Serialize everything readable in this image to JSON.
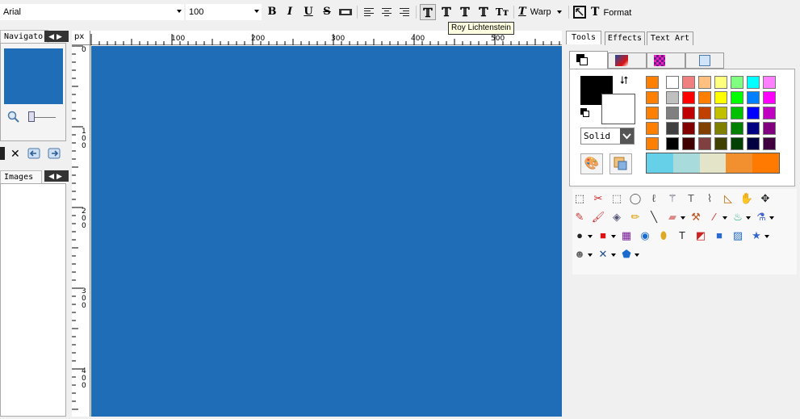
{
  "toolbar": {
    "font_name": "Arial",
    "font_size": "100",
    "bold_label": "B",
    "italic_label": "I",
    "underline_label": "U",
    "strike_label": "S",
    "warp_label": "Warp",
    "format_label": "Format",
    "tooltip": "Roy Lichtenstein"
  },
  "left_panel": {
    "navigator_tab": "Navigator",
    "images_tab": "Images"
  },
  "ruler": {
    "unit": "px",
    "top_labels": [
      "100",
      "200",
      "300",
      "400",
      "500"
    ],
    "left_labels": [
      "0",
      "1\n0\n0",
      "2\n0\n0",
      "3\n0\n0",
      "4\n0\n0"
    ]
  },
  "right_panel": {
    "tabs": [
      "Tools",
      "Effects",
      "Text Art"
    ],
    "line_style": "Solid",
    "palette": [
      [
        "#ffffff",
        "#f08080",
        "#ffc080",
        "#ffff80",
        "#80ff80",
        "#00ffff",
        "#ff80ff"
      ],
      [
        "#c0c0c0",
        "#ff0000",
        "#ff8000",
        "#ffff00",
        "#00ff00",
        "#0080ff",
        "#ff00ff"
      ],
      [
        "#808080",
        "#c00000",
        "#c04000",
        "#c0c000",
        "#00c000",
        "#0000ff",
        "#c000c0"
      ],
      [
        "#404040",
        "#800000",
        "#804000",
        "#808000",
        "#008000",
        "#000080",
        "#800080"
      ],
      [
        "#000000",
        "#400000",
        "#804040",
        "#404000",
        "#004000",
        "#000040",
        "#400040"
      ]
    ],
    "recent_colors": [
      "#ff8000",
      "#ff8000",
      "#ff8000",
      "#ff8000",
      "#ff8000"
    ],
    "gradient_swatches": [
      "#66d0e8",
      "#a8dcdc",
      "#e4e4c8",
      "#f29030",
      "#ff7a00"
    ]
  }
}
